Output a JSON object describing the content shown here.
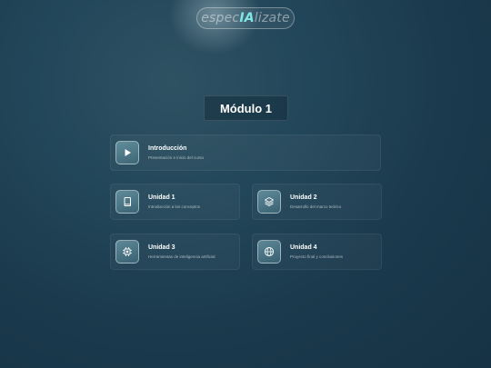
{
  "logo": {
    "part1": "espec",
    "part2": "IA",
    "part3": "lizate"
  },
  "module": {
    "title": "Módulo 1"
  },
  "cards": [
    {
      "title": "Introducción",
      "subtitle": "Presentación e inicio del curso",
      "icon": "play-icon"
    },
    {
      "title": "Unidad 1",
      "subtitle": "Introducción a los conceptos",
      "icon": "book-icon"
    },
    {
      "title": "Unidad 2",
      "subtitle": "Desarrollo del marco teórico",
      "icon": "layers-icon"
    },
    {
      "title": "Unidad 3",
      "subtitle": "Herramientas de inteligencia artificial",
      "icon": "cpu-icon"
    },
    {
      "title": "Unidad 4",
      "subtitle": "Proyecto final y conclusiones",
      "icon": "globe-icon"
    }
  ],
  "colors": {
    "accent": "#7fe6e6",
    "background": "#1b3a4d"
  }
}
